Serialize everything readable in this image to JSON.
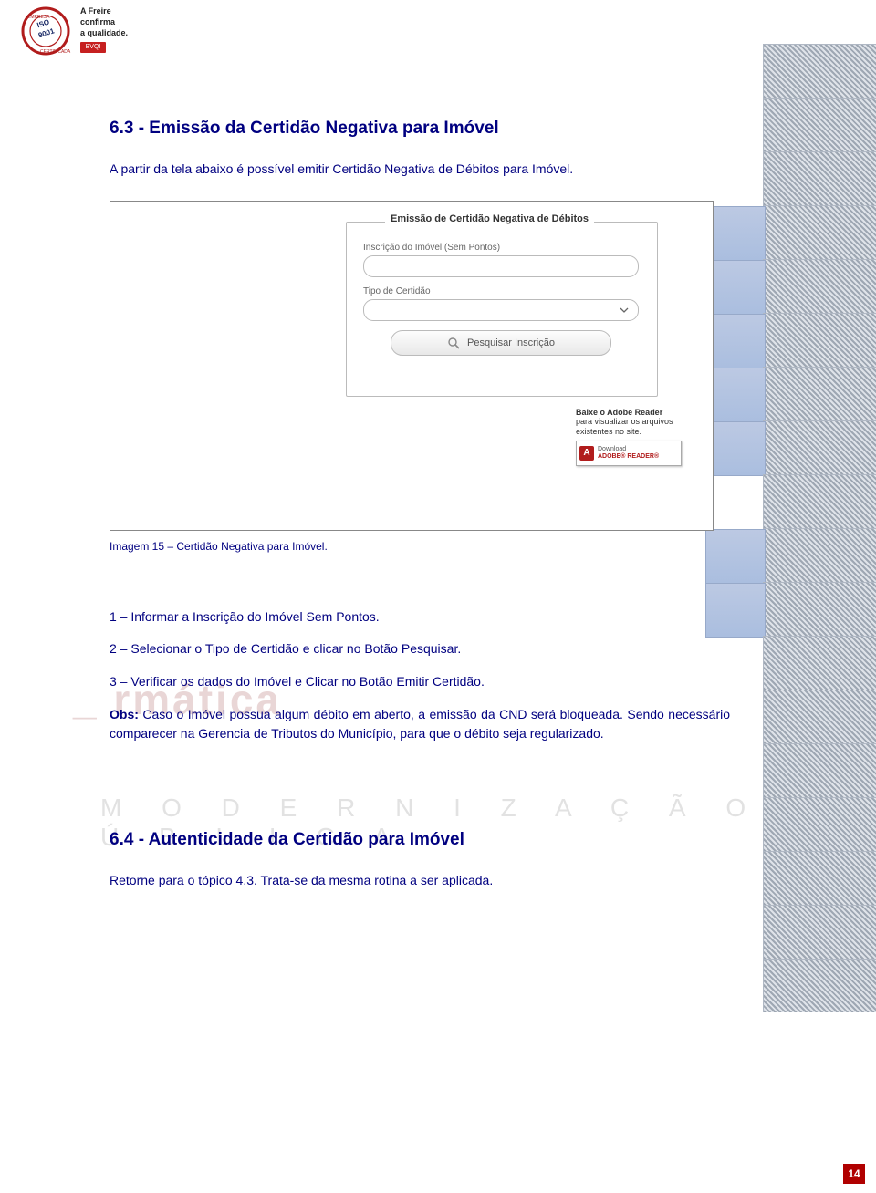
{
  "header": {
    "tagline_line1": "A Freire",
    "tagline_line2": "confirma",
    "tagline_line3": "a qualidade.",
    "badge": "BVQI"
  },
  "section63": {
    "title": "6.3 - Emissão da Certidão Negativa para Imóvel",
    "intro": "A partir da tela abaixo é possível emitir Certidão Negativa de Débitos para Imóvel."
  },
  "screenshot": {
    "fieldset_title": "Emissão de Certidão Negativa de Débitos",
    "label_inscricao": "Inscrição do Imóvel (Sem Pontos)",
    "label_tipo": "Tipo de Certidão",
    "button_search": "Pesquisar Inscrição",
    "adobe_line1": "Baixe o Adobe Reader",
    "adobe_line2": "para visualizar os arquivos",
    "adobe_line3": "existentes no site.",
    "adobe_download": "Download",
    "adobe_reader": "ADOBE® READER®"
  },
  "caption": "Imagem 15 – Certidão Negativa para Imóvel.",
  "steps": {
    "s1": "1 – Informar a Inscrição do Imóvel Sem Pontos.",
    "s2": "2 – Selecionar o Tipo de Certidão e clicar no Botão Pesquisar.",
    "s3": "3 – Verificar os dados do Imóvel e Clicar no Botão Emitir Certidão.",
    "obs_label": "Obs:",
    "obs_text": " Caso o Imóvel possua algum débito em aberto, a emissão da CND será bloqueada. Sendo necessário comparecer na Gerencia de Tributos do Município, para que o débito seja regularizado."
  },
  "section64": {
    "title": "6.4 - Autenticidade da Certidão para Imóvel",
    "text": "Retorne para o tópico 4.3. Trata-se da mesma rotina a ser aplicada."
  },
  "watermark1": "_ rmática",
  "watermark2": "M O D E R N I Z A Ç Ã O   P Ú B L I C A",
  "page_number": "14"
}
